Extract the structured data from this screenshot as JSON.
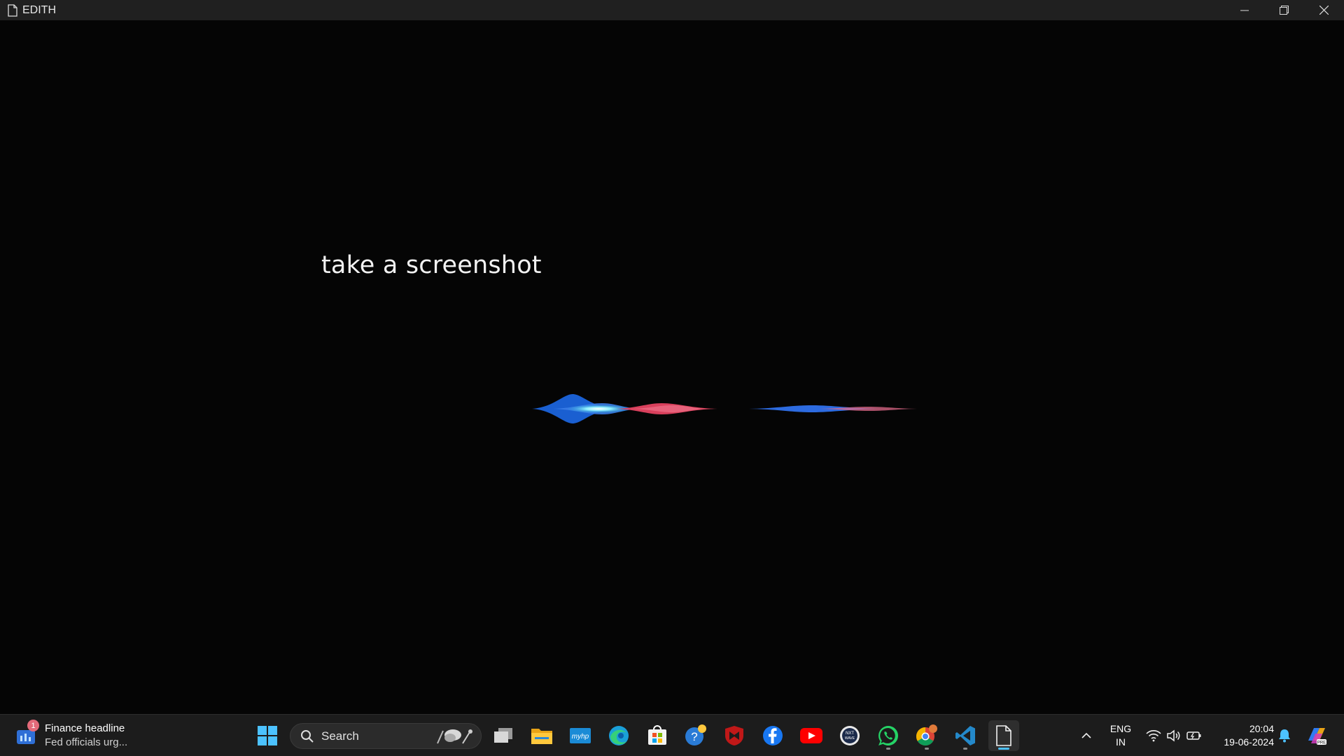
{
  "window": {
    "title": "EDITH",
    "icon": "document-icon",
    "controls": [
      "minimize-icon",
      "restore-icon",
      "close-icon"
    ]
  },
  "main": {
    "transcript": "take a screenshot",
    "waveform_colors": [
      "#1a5fd1",
      "#7fe6ff",
      "#e0445f",
      "#2d6be0",
      "#e06a8a"
    ]
  },
  "taskbar": {
    "widget": {
      "badge": "1",
      "headline": "Finance headline",
      "subline": "Fed officials urg..."
    },
    "search": {
      "label": "Search"
    },
    "apps": [
      "start-icon",
      "task-view-icon",
      "file-explorer-icon",
      "myhp-icon",
      "edge-icon",
      "store-icon",
      "help-icon",
      "mcafee-icon",
      "facebook-icon",
      "youtube-icon",
      "nxtwave-icon",
      "whatsapp-icon",
      "chrome-icon",
      "vscode-icon",
      "edith-icon"
    ],
    "tray": {
      "lang_line1": "ENG",
      "lang_line2": "IN",
      "time": "20:04",
      "date": "19-06-2024"
    },
    "accent": "#4cc2ff"
  }
}
